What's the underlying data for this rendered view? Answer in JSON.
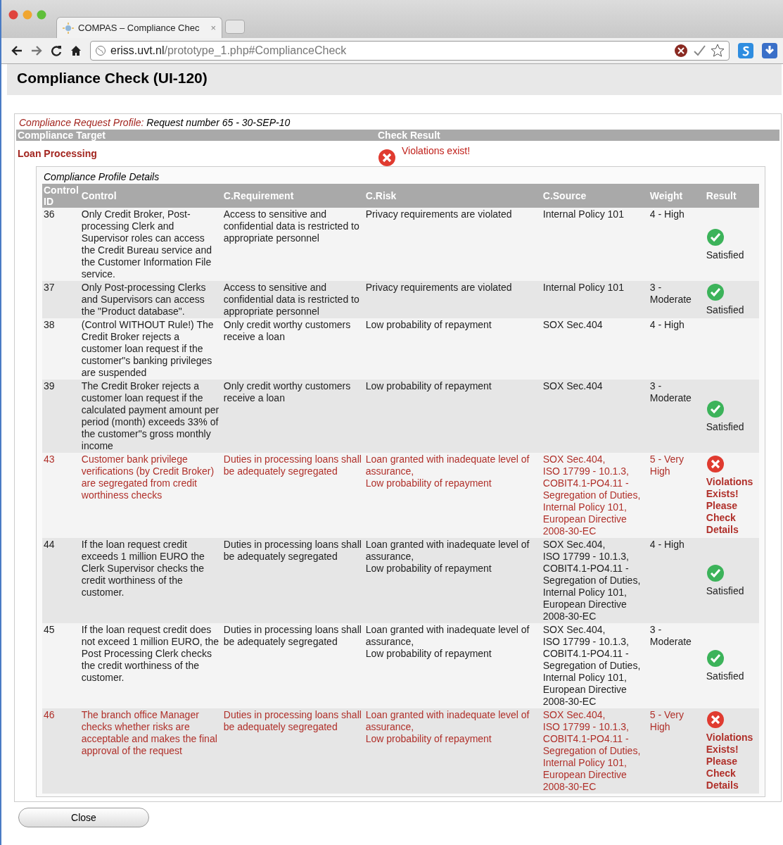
{
  "browser": {
    "tab_title": "COMPAS – Compliance Chec",
    "tab_close": "×",
    "url_host": "eriss.uvt.nl",
    "url_path": "/prototype_1.php#ComplianceCheck"
  },
  "page_title": "Compliance Check (UI-120)",
  "profile": {
    "label": "Compliance Request Profile:",
    "value": "Request number 65 - 30-SEP-10"
  },
  "summary": {
    "target_heading": "Compliance Target",
    "result_heading": "Check Result",
    "target": "Loan Processing",
    "violations": true,
    "result_text": "Violations exist!"
  },
  "details": {
    "title": "Compliance Profile Details",
    "columns": [
      "Control ID",
      "Control",
      "C.Requirement",
      "C.Risk",
      "C.Source",
      "Weight",
      "Result"
    ],
    "rows": [
      {
        "id": "36",
        "violated": false,
        "control": "Only Credit Broker, Post-processing Clerk and Supervisor roles can access the Credit Bureau service and the Customer Information File service.",
        "requirement": "Access to sensitive and confidential data is restricted to appropriate personnel",
        "risk": [
          "Privacy requirements are violated"
        ],
        "source": [
          "Internal Policy 101"
        ],
        "weight": "4 - High",
        "result": {
          "satisfied": true,
          "label": "Satisfied"
        }
      },
      {
        "id": "37",
        "violated": false,
        "control": "Only Post-processing Clerks and Supervisors can access the \"Product database\".",
        "requirement": "Access to sensitive and confidential data is restricted to appropriate personnel",
        "risk": [
          "Privacy requirements are violated"
        ],
        "source": [
          "Internal Policy 101"
        ],
        "weight": "3 - Moderate",
        "result": {
          "satisfied": true,
          "label": "Satisfied"
        }
      },
      {
        "id": "38",
        "violated": false,
        "control": "(Control WITHOUT Rule!) The Credit Broker rejects a customer loan request if the customer\"s banking privileges are suspended",
        "requirement": "Only credit worthy customers receive a loan",
        "risk": [
          "Low probability of repayment"
        ],
        "source": [
          "SOX Sec.404"
        ],
        "weight": "4 - High"
      },
      {
        "id": "39",
        "violated": false,
        "control": "The Credit Broker rejects a customer loan request if the calculated payment amount per period (month) exceeds 33% of the customer\"s gross monthly income",
        "requirement": "Only credit worthy customers receive a loan",
        "risk": [
          "Low probability of repayment"
        ],
        "source": [
          "SOX Sec.404"
        ],
        "weight": "3 - Moderate",
        "result": {
          "satisfied": true,
          "label": "Satisfied"
        }
      },
      {
        "id": "43",
        "violated": true,
        "control": "Customer bank privilege verifications (by Credit Broker) are segregated from credit worthiness checks",
        "requirement": "Duties in processing loans shall be adequately segregated",
        "risk": [
          "Loan granted with inadequate level of assurance,",
          "Low probability of repayment"
        ],
        "source": [
          "SOX Sec.404,",
          "ISO 17799 - 10.1.3,",
          "COBIT4.1-PO4.11 - Segregation of Duties,",
          "Internal Policy 101,",
          "European Directive 2008-30-EC"
        ],
        "weight": "5 - Very High",
        "result": {
          "satisfied": false,
          "label": "Violations Exists! Please Check Details"
        }
      },
      {
        "id": "44",
        "violated": false,
        "control": "If the loan request credit exceeds 1 million EURO the Clerk Supervisor checks the credit worthiness of the customer.",
        "requirement": "Duties in processing loans shall be adequately segregated",
        "risk": [
          "Loan granted with inadequate level of assurance,",
          "Low probability of repayment"
        ],
        "source": [
          "SOX Sec.404,",
          "ISO 17799 - 10.1.3,",
          "COBIT4.1-PO4.11 - Segregation of Duties,",
          "Internal Policy 101,",
          "European Directive 2008-30-EC"
        ],
        "weight": "4 - High",
        "result": {
          "satisfied": true,
          "label": "Satisfied"
        }
      },
      {
        "id": "45",
        "violated": false,
        "control": "If the loan request credit does not exceed 1 million EURO, the Post Processing Clerk checks the credit worthiness of the customer.",
        "requirement": "Duties in processing loans shall be adequately segregated",
        "risk": [
          "Loan granted with inadequate level of assurance,",
          "Low probability of repayment"
        ],
        "source": [
          "SOX Sec.404,",
          "ISO 17799 - 10.1.3,",
          "COBIT4.1-PO4.11 - Segregation of Duties,",
          "Internal Policy 101,",
          "European Directive 2008-30-EC"
        ],
        "weight": "3 - Moderate",
        "result": {
          "satisfied": true,
          "label": "Satisfied"
        }
      },
      {
        "id": "46",
        "violated": true,
        "control": "The branch office Manager checks whether risks are acceptable and makes the final approval of the request",
        "requirement": "Duties in processing loans shall be adequately segregated",
        "risk": [
          "Loan granted with inadequate level of assurance,",
          "Low probability of repayment"
        ],
        "source": [
          "SOX Sec.404,",
          "ISO 17799 - 10.1.3,",
          "COBIT4.1-PO4.11 - Segregation of Duties,",
          "Internal Policy 101,",
          "European Directive 2008-30-EC"
        ],
        "weight": "5 - Very High",
        "result": {
          "satisfied": false,
          "label": "Violations Exists! Please Check Details"
        }
      }
    ]
  },
  "close_button": "Close"
}
